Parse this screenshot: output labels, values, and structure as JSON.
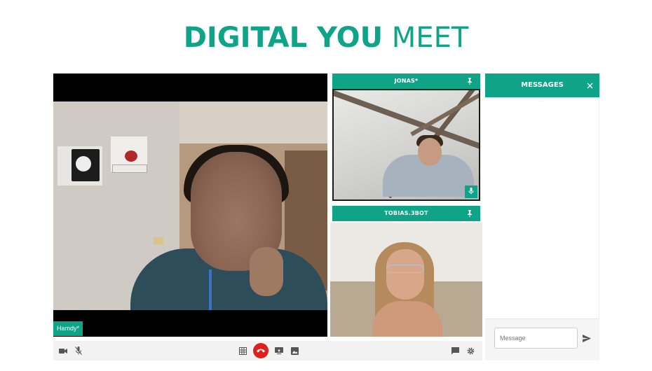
{
  "header": {
    "title_bold": "DIGITAL YOU",
    "title_light": "MEET"
  },
  "main_video": {
    "participant_name": "Hamdy*"
  },
  "participants": [
    {
      "name": "JONAS*",
      "pin_icon": "pin-icon",
      "mic_icon": "mic-icon"
    },
    {
      "name": "TOBIAS.3BOT",
      "pin_icon": "pin-icon"
    }
  ],
  "messages": {
    "title": "MESSAGES",
    "close_icon": "close-icon",
    "input_placeholder": "Message",
    "send_icon": "send-icon"
  },
  "controls": {
    "left": [
      "camera-icon",
      "mic-off-icon"
    ],
    "center": [
      "grid-icon",
      "hangup-icon",
      "screen-share-icon",
      "image-icon"
    ],
    "right": [
      "chat-icon",
      "settings-icon"
    ]
  },
  "colors": {
    "accent": "#0fa387",
    "hangup": "#e0201f"
  }
}
